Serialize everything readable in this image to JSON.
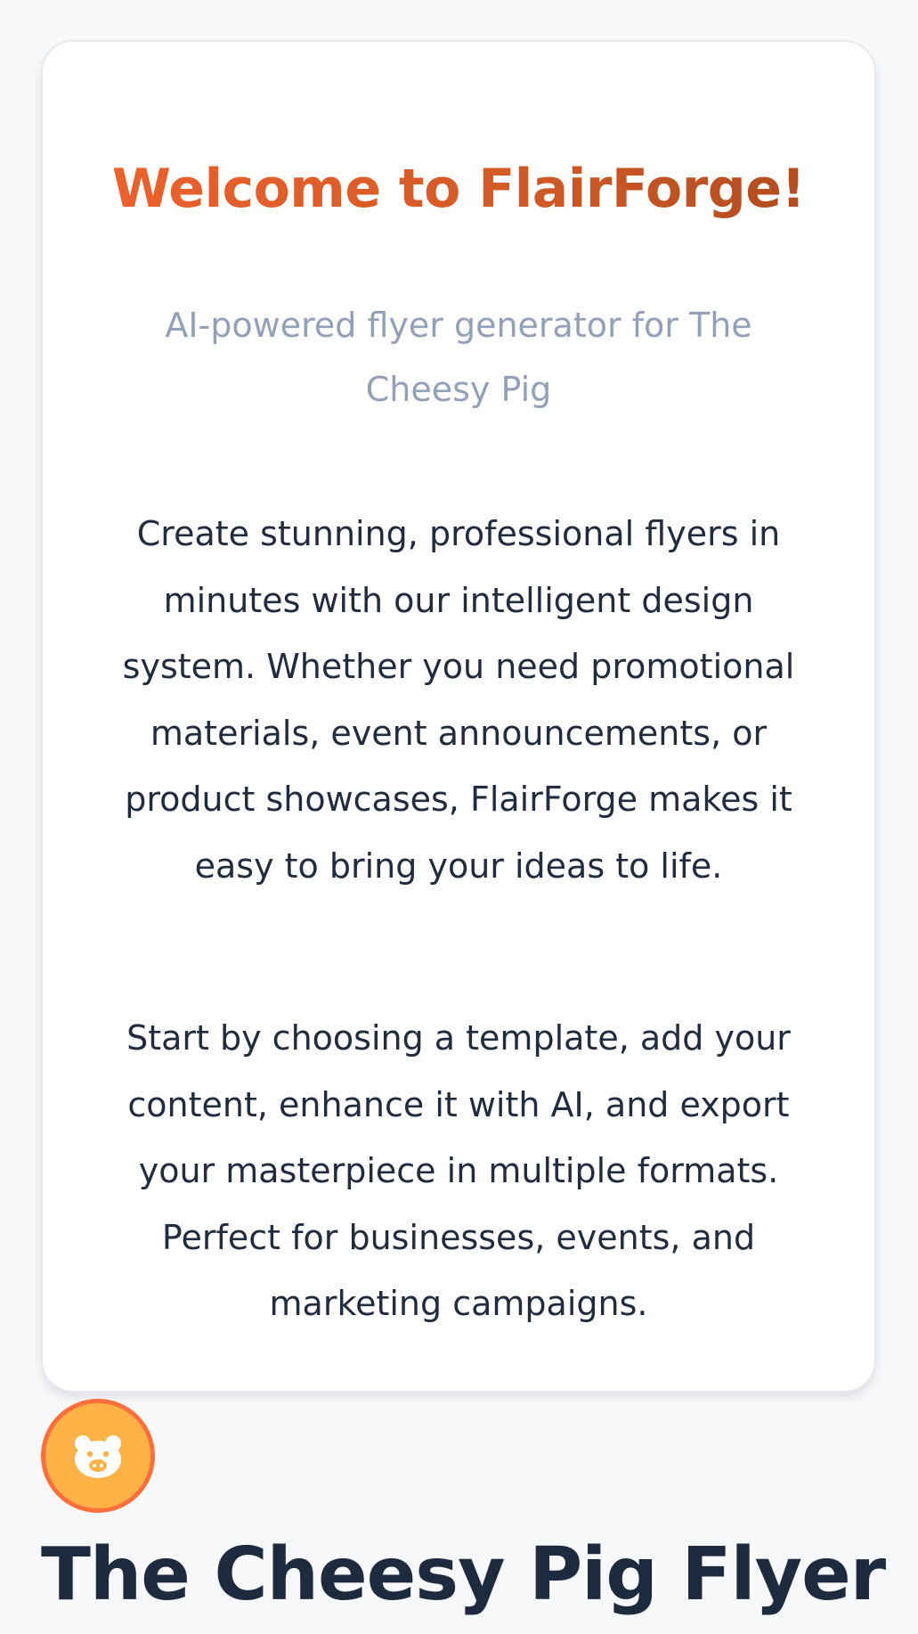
{
  "welcome_card": {
    "title": "Welcome to FlairForge!",
    "subtitle": "AI-powered flyer generator for The Cheesy Pig",
    "paragraph_1": "Create stunning, professional flyers in minutes with our intelligent design system. Whether you need promotional materials, event announcements, or product showcases, FlairForge makes it easy to bring your ideas to life.",
    "paragraph_2": "Start by choosing a template, add your content, enhance it with AI, and export your masterpiece in multiple formats. Perfect for businesses, events, and marketing campaigns."
  },
  "brand": {
    "logo_icon": "pig-face-icon",
    "badge_color": "#ffb347",
    "badge_border_color": "#ff6f3c"
  },
  "page": {
    "title": "The Cheesy Pig Flyer"
  },
  "colors": {
    "title_gradient_start": "#f0622d",
    "title_gradient_end": "#ab4a1f",
    "subtitle": "#93a1b8",
    "body_text": "#222c3f",
    "heading": "#1e2a3d",
    "background": "#f7f8fa"
  }
}
